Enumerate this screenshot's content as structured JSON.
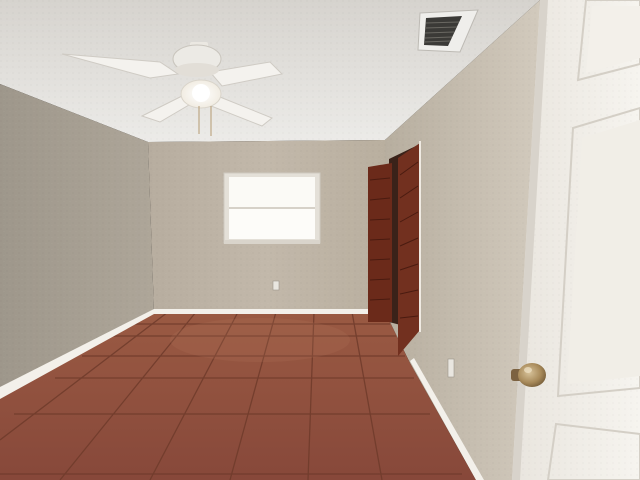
{
  "scene": {
    "kind": "empty bedroom interior photo",
    "elements": [
      "ceiling-fan",
      "ceiling-vent",
      "window",
      "closet-bifold-doors",
      "tile-floor",
      "interior-door",
      "door-knob",
      "wall-outlet"
    ]
  },
  "colors": {
    "ceiling": "#e6e3de",
    "left_wall": "#a49e92",
    "back_wall": "#bdb3a5",
    "right_wall": "#c8bfb2",
    "floor": "#8f4f3a",
    "floor_grout": "#6e3a2a",
    "baseboard": "#f3f0ea",
    "closet_wood": "#6b2a1a",
    "door_white": "#f2efe9",
    "window_glass": "#fbfaf6",
    "knob_brass": "#a88a5a"
  }
}
